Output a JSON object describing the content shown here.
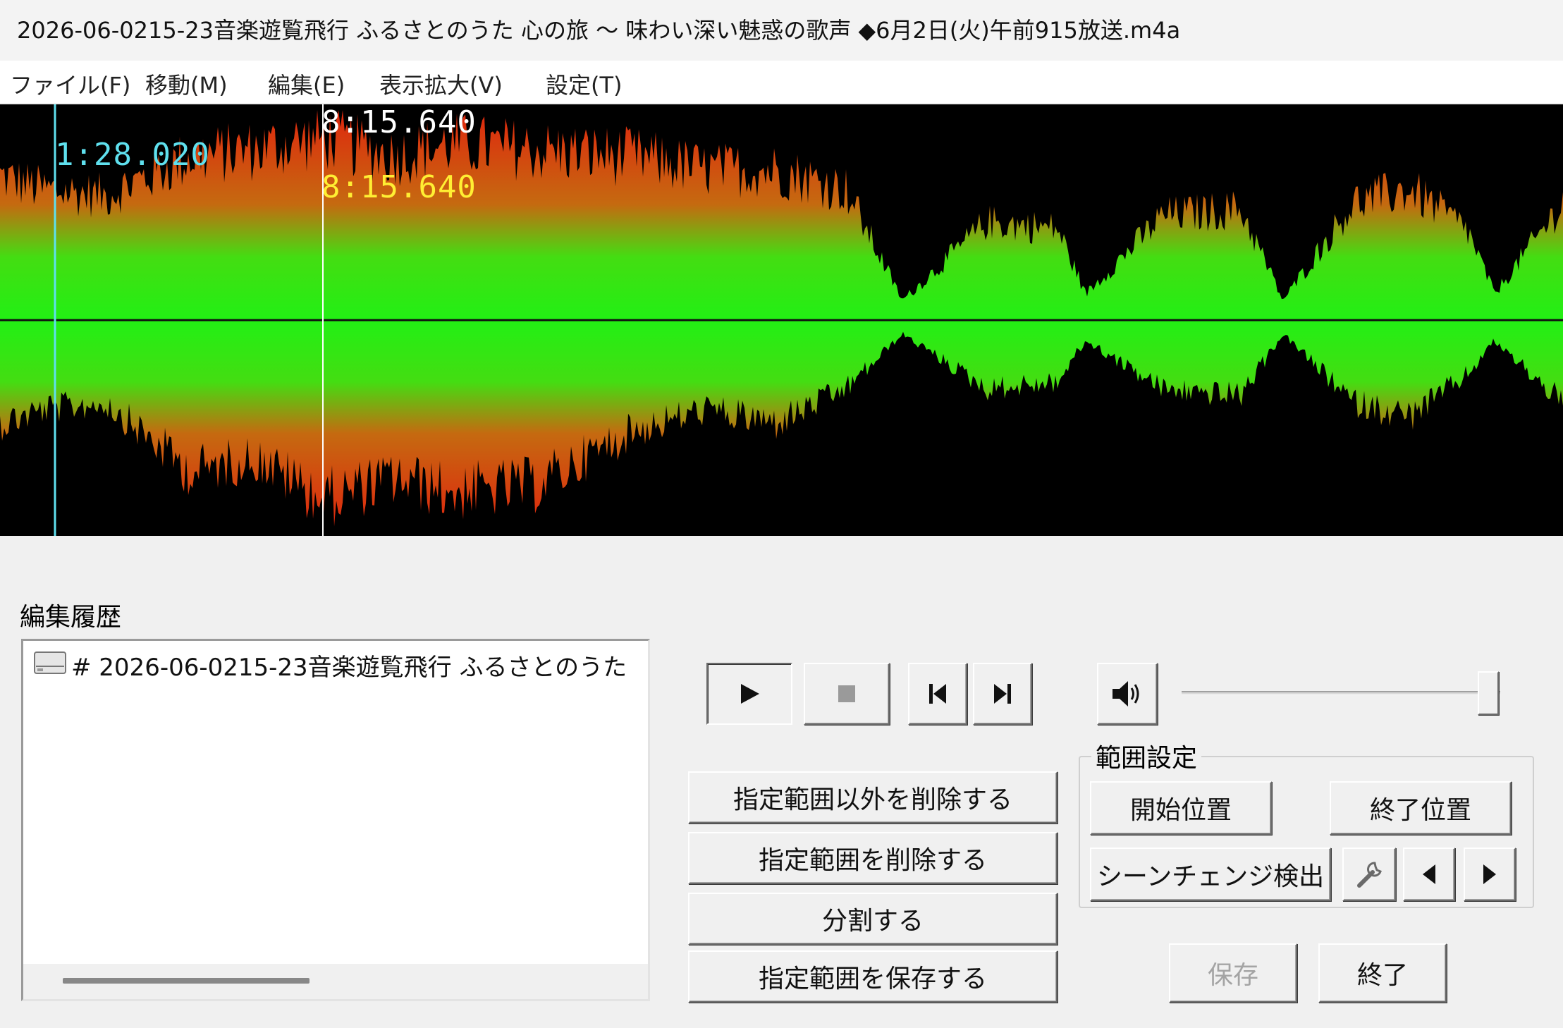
{
  "window": {
    "title": "2026-06-0215-23音楽遊覧飛行 ふるさとのうた 心の旅 ～ 味わい深い魅惑の歌声 ◆6月2日(火)午前915放送.m4a"
  },
  "menu": [
    {
      "label": "ファイル(F)"
    },
    {
      "label": "移動(M)"
    },
    {
      "label": "編集(E)"
    },
    {
      "label": "表示拡大(V)"
    },
    {
      "label": "設定(T)"
    }
  ],
  "waveform": {
    "cursor_time": "1:28.020",
    "selection_start_time": "8:15.640",
    "selection_end_time": "8:15.640",
    "colors": {
      "background": "#000000",
      "low": "#22ee11",
      "high": "#e02a10",
      "cursor": "#5fe0ee",
      "selection_start": "#ffffff",
      "selection_end": "#ffee33"
    }
  },
  "history": {
    "label": "編集履歴",
    "items": [
      {
        "text": "# 2026-06-0215-23音楽遊覧飛行 ふるさとのうた"
      }
    ]
  },
  "transport": {
    "play_icon": "play-icon",
    "stop_icon": "stop-icon",
    "prev_icon": "skip-previous-icon",
    "next_icon": "skip-next-icon",
    "volume_icon": "speaker-icon",
    "volume_level_fraction": 0.98
  },
  "actions": {
    "delete_outside": "指定範囲以外を削除する",
    "delete_range": "指定範囲を削除する",
    "split": "分割する",
    "save_range": "指定範囲を保存する"
  },
  "range": {
    "group_label": "範囲設定",
    "start_button": "開始位置",
    "end_button": "終了位置",
    "scene_detect_button": "シーンチェンジ検出",
    "settings_icon": "wrench-icon",
    "prev_icon": "triangle-left-icon",
    "next_icon": "triangle-right-icon"
  },
  "footer": {
    "save_button": "保存",
    "exit_button": "終了"
  }
}
